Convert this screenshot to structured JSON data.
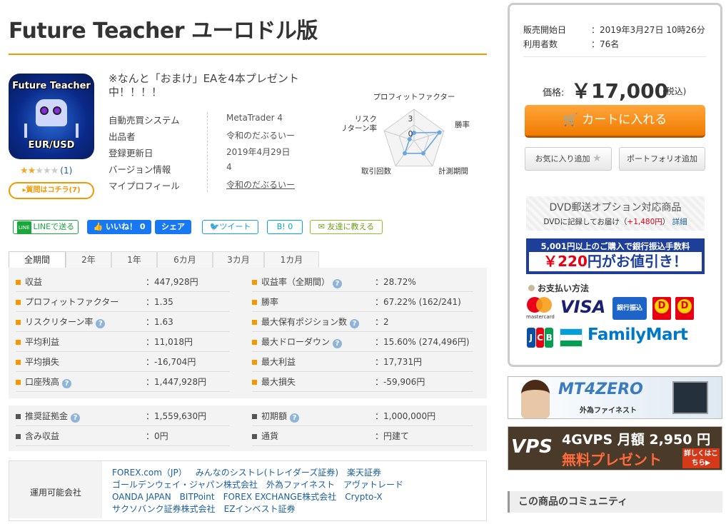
{
  "title": "Future Teacher ユーロドル版",
  "logo": {
    "line1": "Future Teacher",
    "line2": "EUR/USD"
  },
  "rating": {
    "stars": 2,
    "max": 5,
    "count_text": "(1)"
  },
  "question_button": "▸質問はコチラ(7)",
  "headline": "※なんと「おまけ」EAを4本プレゼント中！！！！",
  "info": [
    {
      "key": "自動売買システム",
      "value": "MetaTrader 4",
      "link": false
    },
    {
      "key": "出品者",
      "value": "令和のだぶるいー",
      "link": false
    },
    {
      "key": "登録更新日",
      "value": "2019年4月29日",
      "link": false
    },
    {
      "key": "バージョン情報",
      "value": "4",
      "link": false
    },
    {
      "key": "マイプロフィール",
      "value": "令和のだぶるいー",
      "link": true
    }
  ],
  "radar": {
    "axes": [
      "プロフィットファクター",
      "勝率",
      "計測期間",
      "取引回数",
      "リスクリターン率"
    ],
    "scale_labels": [
      "3",
      "0"
    ],
    "values": [
      0.25,
      0.85,
      0.5,
      0.5,
      0.15
    ],
    "color": "#6aa6e0"
  },
  "social": {
    "line": "LINEで送る",
    "like": "いいね！ 0",
    "share": "シェア",
    "tweet": "ツイート",
    "hatena": "B! 0",
    "friend": "友達に教える"
  },
  "tabs": [
    "全期間",
    "2年",
    "1年",
    "6カ月",
    "3カ月",
    "1カ月"
  ],
  "stats": {
    "left": [
      {
        "key": "収益",
        "value": "：447,928円",
        "help": false
      },
      {
        "key": "プロフィットファクター",
        "value": "：1.35",
        "help": false
      },
      {
        "key": "リスクリターン率",
        "value": "：1.63",
        "help": true
      },
      {
        "key": "平均利益",
        "value": "：11,018円",
        "help": false
      },
      {
        "key": "平均損失",
        "value": "：-16,704円",
        "help": false
      },
      {
        "key": "口座残高",
        "value": "：1,447,928円",
        "help": true
      }
    ],
    "right": [
      {
        "key": "収益率（全期間）",
        "value": "：28.72%",
        "help": true
      },
      {
        "key": "勝率",
        "value": "：67.22% (162/241)",
        "help": false
      },
      {
        "key": "最大保有ポジション数",
        "value": "：2",
        "help": true
      },
      {
        "key": "最大ドローダウン",
        "value": "：15.60% (274,496円)",
        "help": true
      },
      {
        "key": "最大利益",
        "value": "：17,731円",
        "help": false
      },
      {
        "key": "最大損失",
        "value": "：-59,906円",
        "help": false
      }
    ]
  },
  "stats2": {
    "left": [
      {
        "key": "推奨証拠金",
        "value": "：1,559,630円",
        "help": true
      },
      {
        "key": "含み収益",
        "value": "：0円",
        "help": false
      }
    ],
    "right": [
      {
        "key": "初期額",
        "value": "：1,000,000円",
        "help": true
      },
      {
        "key": "通貨",
        "value": "：円建て",
        "help": false
      }
    ]
  },
  "brokers": {
    "label": "運用可能会社",
    "lines": [
      [
        "FOREX.com（JP）",
        "みんなのシストレ(トレイダーズ証券)",
        "楽天証券"
      ],
      [
        "ゴールデンウェイ・ジャパン株式会社",
        "外為ファイネスト",
        "アヴァトレード"
      ],
      [
        "OANDA JAPAN",
        "BITPoint",
        "FOREX EXCHANGE株式会社",
        "Crypto-X"
      ],
      [
        "サクソバンク証券株式会社",
        "EZインベスト証券"
      ]
    ]
  },
  "panel": {
    "sale_start_label": "販売開始日",
    "sale_start_value": "：2019年3月27日 10時26分",
    "users_label": "利用者数",
    "users_value": "：76名",
    "price_label": "価格:",
    "price": "￥17,000",
    "tax": "(税込)",
    "cart": "カートに入れる",
    "fav": "お気に入り追加",
    "portfolio": "ポートフォリオ追加",
    "dvd_title": "DVD郵送オプション対応商品",
    "dvd_sub_a": "DVDに記録してお届け（",
    "dvd_sub_price": "+1,480円",
    "dvd_sub_b": "）",
    "dvd_detail": "詳細",
    "promo_top": "5,001円以上のご購入で銀行振込手数料",
    "promo_yen": "￥220",
    "promo_rest": "円がお値引き！",
    "pay_title": "お支払い方法",
    "pay": {
      "mastercard": "mastercard",
      "visa": "VISA",
      "bank": "銀行振込",
      "familymart": "FamilyMart"
    }
  },
  "banners": {
    "mt4_title": "MT4ZERO",
    "mt4_sub": "外為ファイネスト",
    "vps_logo": "VPS",
    "vps_top": "4GVPS 月額 2,950 円",
    "vps_bot": "無料プレゼント",
    "vps_more": "詳しくはこちら▶"
  },
  "community": "この商品のコミュニティ"
}
